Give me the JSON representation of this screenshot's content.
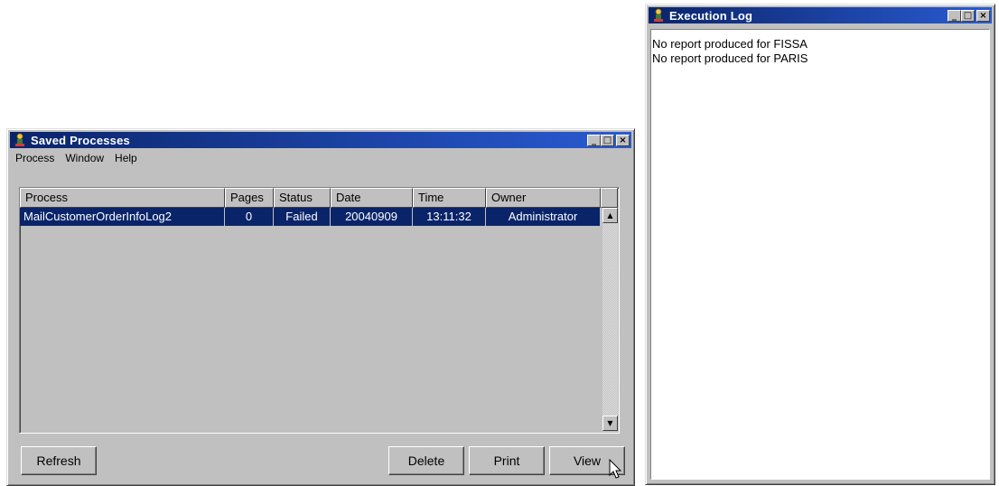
{
  "saved_processes": {
    "title": "Saved Processes",
    "menu": [
      "Process",
      "Window",
      "Help"
    ],
    "columns": [
      "Process",
      "Pages",
      "Status",
      "Date",
      "Time",
      "Owner"
    ],
    "rows": [
      {
        "process": "MailCustomerOrderInfoLog2",
        "pages": "0",
        "status": "Failed",
        "date": "20040909",
        "time": "13:11:32",
        "owner": "Administrator",
        "selected": true
      }
    ],
    "buttons": {
      "refresh": "Refresh",
      "delete": "Delete",
      "print": "Print",
      "view": "View"
    }
  },
  "execution_log": {
    "title": "Execution Log",
    "lines": [
      "No report produced for FISSA",
      "No report produced for PARIS"
    ]
  },
  "title_buttons": {
    "minimize": "_",
    "maximize": "□",
    "close": "×"
  },
  "icons": {
    "app": "wizard-app-icon",
    "scroll_up": "scroll-up-arrow-icon",
    "scroll_down": "scroll-down-arrow-icon",
    "cursor": "mouse-pointer-icon"
  },
  "colors": {
    "titlebar": "#0a246a",
    "selection": "#0a246a",
    "face": "#c0c0c0"
  }
}
